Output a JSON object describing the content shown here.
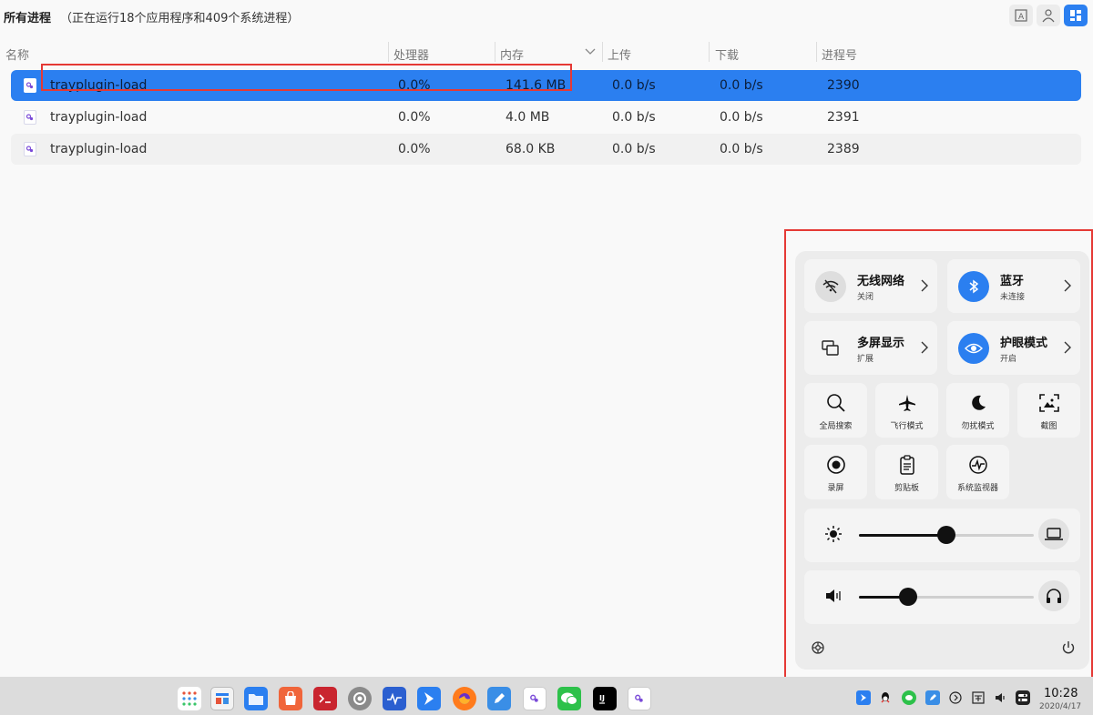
{
  "header": {
    "title": "所有进程",
    "subtitle": "（正在运行18个应用程序和409个系统进程）",
    "view_buttons": [
      "text-view-icon",
      "user-view-icon",
      "process-tree-icon"
    ]
  },
  "table": {
    "columns": [
      "名称",
      "处理器",
      "内存",
      "上传",
      "下载",
      "进程号"
    ],
    "sort_column": "内存",
    "rows": [
      {
        "name": "trayplugin-load",
        "cpu": "0.0%",
        "mem": "141.6 MB",
        "up": "0.0 b/s",
        "down": "0.0 b/s",
        "pid": "2390",
        "selected": true
      },
      {
        "name": "trayplugin-load",
        "cpu": "0.0%",
        "mem": "4.0 MB",
        "up": "0.0 b/s",
        "down": "0.0 b/s",
        "pid": "2391",
        "selected": false
      },
      {
        "name": "trayplugin-load",
        "cpu": "0.0%",
        "mem": "68.0 KB",
        "up": "0.0 b/s",
        "down": "0.0 b/s",
        "pid": "2389",
        "selected": false
      }
    ]
  },
  "control_center": {
    "wifi": {
      "title": "无线网络",
      "status": "关闭"
    },
    "bluetooth": {
      "title": "蓝牙",
      "status": "未连接"
    },
    "multiscreen": {
      "title": "多屏显示",
      "status": "扩展"
    },
    "eyecare": {
      "title": "护眼模式",
      "status": "开启"
    },
    "quick_actions": [
      "全局搜索",
      "飞行模式",
      "勿扰模式",
      "截图",
      "录屏",
      "剪贴板",
      "系统监视器"
    ],
    "brightness_level": 0.5,
    "volume_level": 0.28
  },
  "taskbar": {
    "time": "10:28",
    "date": "2020/4/17"
  },
  "colors": {
    "accent": "#2b7ff0",
    "highlight_box": "#e53935"
  }
}
